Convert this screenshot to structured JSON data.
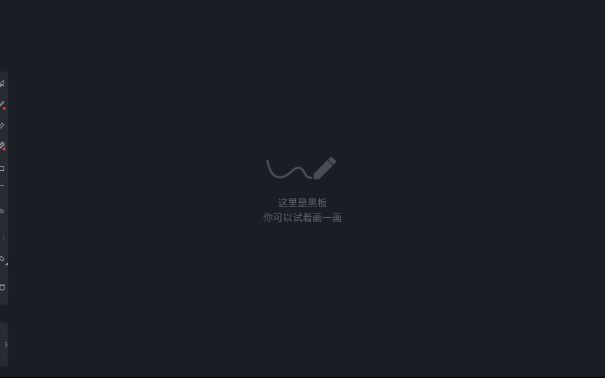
{
  "canvas": {
    "background": "#1a1d23",
    "empty_state": {
      "icon": "squiggle-pencil-icon",
      "line1": "这里是黑板",
      "line2": "你可以试着画一画",
      "text_color": "#5e636c"
    }
  },
  "toolbar": {
    "tools": [
      {
        "icon": "mouse-pointer-icon"
      },
      {
        "icon": "pen-icon",
        "badge_color": "#e53935"
      },
      {
        "icon": "highlighter-icon"
      },
      {
        "icon": "marker-icon",
        "badge_color": "#e53935",
        "active": true
      },
      {
        "icon": "rectangle-icon"
      },
      {
        "icon": "text-icon"
      },
      {
        "icon": "laser-pointer-icon"
      },
      {
        "icon": "divider-icon"
      },
      {
        "icon": "eraser-icon",
        "has_submenu": true
      },
      {
        "icon": "clear-icon"
      }
    ]
  },
  "pages": {
    "current": "3"
  }
}
